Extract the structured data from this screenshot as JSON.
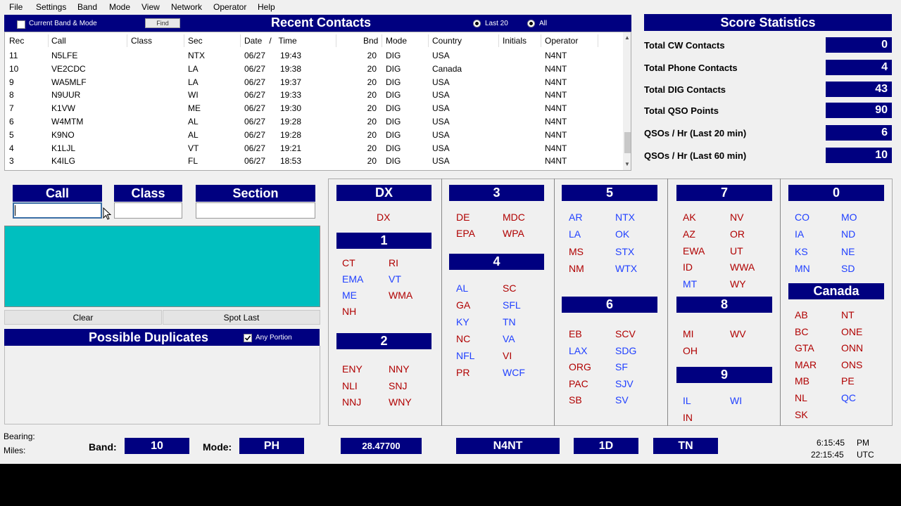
{
  "menu": [
    "File",
    "Settings",
    "Band",
    "Mode",
    "View",
    "Network",
    "Operator",
    "Help"
  ],
  "recent": {
    "title": "Recent Contacts",
    "filter_label": "Current Band & Mode",
    "find_label": "Find",
    "radio_last20": "Last 20",
    "radio_all": "All",
    "columns": {
      "rec": "Rec",
      "call": "Call",
      "class": "Class",
      "sec": "Sec",
      "datetime": "Date   /   Time",
      "bnd": "Bnd",
      "mode": "Mode",
      "country": "Country",
      "initials": "Initials",
      "operator": "Operator"
    },
    "rows": [
      {
        "rec": "11",
        "call": "N5LFE",
        "sec": "NTX",
        "date": "06/27",
        "time": "19:43",
        "bnd": "20",
        "mode": "DIG",
        "country": "USA",
        "op": "N4NT"
      },
      {
        "rec": "10",
        "call": "VE2CDC",
        "sec": "LA",
        "date": "06/27",
        "time": "19:38",
        "bnd": "20",
        "mode": "DIG",
        "country": "Canada",
        "op": "N4NT"
      },
      {
        "rec": "9",
        "call": "WA5MLF",
        "sec": "LA",
        "date": "06/27",
        "time": "19:37",
        "bnd": "20",
        "mode": "DIG",
        "country": "USA",
        "op": "N4NT"
      },
      {
        "rec": "8",
        "call": "N9UUR",
        "sec": "WI",
        "date": "06/27",
        "time": "19:33",
        "bnd": "20",
        "mode": "DIG",
        "country": "USA",
        "op": "N4NT"
      },
      {
        "rec": "7",
        "call": "K1VW",
        "sec": "ME",
        "date": "06/27",
        "time": "19:30",
        "bnd": "20",
        "mode": "DIG",
        "country": "USA",
        "op": "N4NT"
      },
      {
        "rec": "6",
        "call": "W4MTM",
        "sec": "AL",
        "date": "06/27",
        "time": "19:28",
        "bnd": "20",
        "mode": "DIG",
        "country": "USA",
        "op": "N4NT"
      },
      {
        "rec": "5",
        "call": "K9NO",
        "sec": "AL",
        "date": "06/27",
        "time": "19:28",
        "bnd": "20",
        "mode": "DIG",
        "country": "USA",
        "op": "N4NT"
      },
      {
        "rec": "4",
        "call": "K1LJL",
        "sec": "VT",
        "date": "06/27",
        "time": "19:21",
        "bnd": "20",
        "mode": "DIG",
        "country": "USA",
        "op": "N4NT"
      },
      {
        "rec": "3",
        "call": "K4ILG",
        "sec": "FL",
        "date": "06/27",
        "time": "18:53",
        "bnd": "20",
        "mode": "DIG",
        "country": "USA",
        "op": "N4NT"
      }
    ]
  },
  "score": {
    "title": "Score Statistics",
    "items": [
      {
        "label": "Total CW Contacts",
        "value": "0"
      },
      {
        "label": "Total Phone Contacts",
        "value": "4"
      },
      {
        "label": "Total DIG Contacts",
        "value": "43"
      },
      {
        "label": "Total QSO Points",
        "value": "90"
      },
      {
        "label": "QSOs / Hr (Last 20 min)",
        "value": "6"
      },
      {
        "label": "QSOs / Hr (Last 60 min)",
        "value": "10"
      }
    ]
  },
  "entry": {
    "call_label": "Call",
    "class_label": "Class",
    "section_label": "Section",
    "call_value": "",
    "class_value": "",
    "section_value": "",
    "clear_label": "Clear",
    "spot_last_label": "Spot Last",
    "dup_title": "Possible Duplicates",
    "any_portion_label": "Any Portion"
  },
  "sections": {
    "dx_header": "DX",
    "h1": "1",
    "h2": "2",
    "h3": "3",
    "h4": "4",
    "h5": "5",
    "h6": "6",
    "h7": "7",
    "h8": "8",
    "h9": "9",
    "h0": "0",
    "canada_header": "Canada",
    "dx": [
      "DX"
    ],
    "d1": [
      "CT",
      "RI",
      "EMA",
      "VT",
      "ME",
      "WMA",
      "NH"
    ],
    "d2": [
      "ENY",
      "NNY",
      "NLI",
      "SNJ",
      "NNJ",
      "WNY"
    ],
    "d3": [
      "DE",
      "MDC",
      "EPA",
      "WPA"
    ],
    "d4": [
      "AL",
      "SC",
      "GA",
      "SFL",
      "KY",
      "TN",
      "NC",
      "VA",
      "NFL",
      "VI",
      "PR",
      "WCF"
    ],
    "d5": [
      "AR",
      "NTX",
      "LA",
      "OK",
      "MS",
      "STX",
      "NM",
      "WTX"
    ],
    "d6": [
      "EB",
      "SCV",
      "LAX",
      "SDG",
      "ORG",
      "SF",
      "PAC",
      "SJV",
      "SB",
      "SV"
    ],
    "d7": [
      "AK",
      "NV",
      "AZ",
      "OR",
      "EWA",
      "UT",
      "ID",
      "WWA",
      "MT",
      "WY"
    ],
    "d8": [
      "MI",
      "WV",
      "OH"
    ],
    "d9": [
      "IL",
      "WI",
      "IN"
    ],
    "d0": [
      "CO",
      "MO",
      "IA",
      "ND",
      "KS",
      "NE",
      "MN",
      "SD"
    ],
    "canada": [
      "AB",
      "NT",
      "BC",
      "ONE",
      "GTA",
      "ONN",
      "MAR",
      "ONS",
      "MB",
      "PE",
      "NL",
      "QC",
      "SK"
    ],
    "colors": {
      "worked": "#2040ff",
      "needed": "#b00000"
    }
  },
  "status": {
    "bearing_label": "Bearing:",
    "miles_label": "Miles:",
    "band_label": "Band:",
    "band_value": "10",
    "mode_label": "Mode:",
    "mode_value": "PH",
    "freq": "28.47700",
    "operator": "N4NT",
    "class": "1D",
    "section": "TN",
    "local_time": "6:15:45",
    "local_ampm": "PM",
    "utc_time": "22:15:45",
    "utc_label": "UTC"
  }
}
